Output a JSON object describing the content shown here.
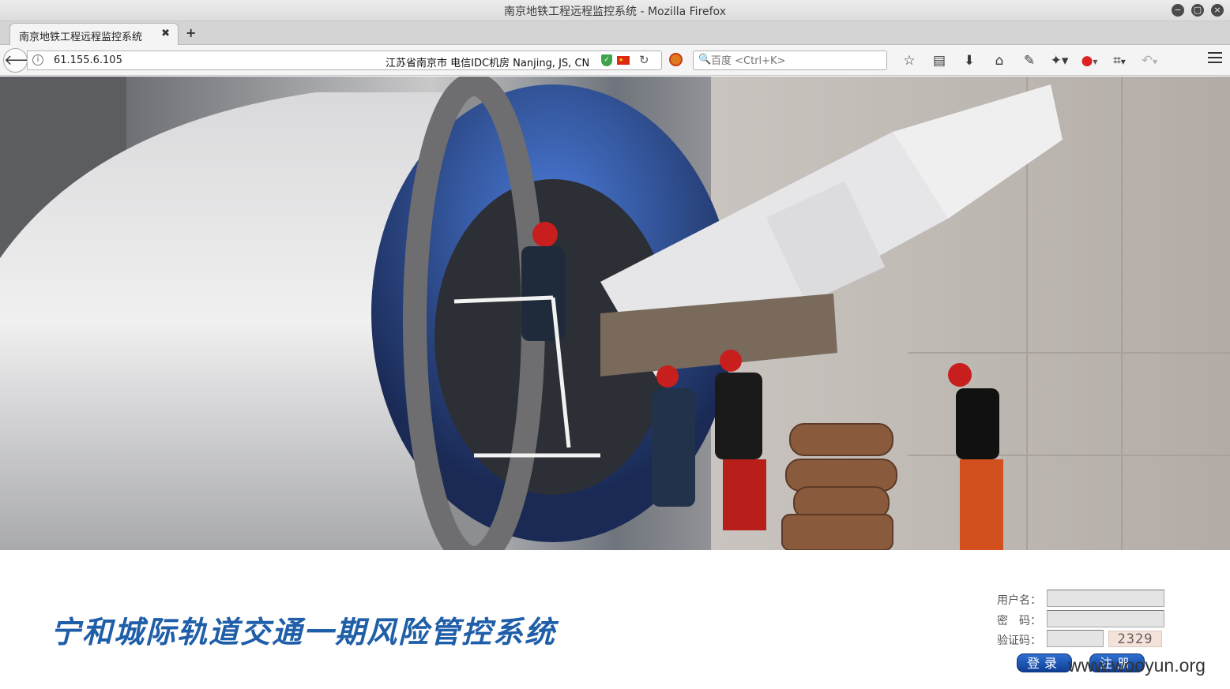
{
  "window": {
    "title": "南京地铁工程远程监控系统 - Mozilla Firefox",
    "controls": [
      "−",
      "▢",
      "×"
    ]
  },
  "tabs": [
    {
      "label": "南京地铁工程远程监控系统",
      "close": "✖",
      "active": true
    }
  ],
  "new_tab_label": "+",
  "navbar": {
    "back_icon": "arrow-left-icon",
    "url": "61.155.6.105",
    "geo_info": "江苏省南京市 电信IDC机房   Nanjing, JS, CN",
    "search_placeholder": "百度 <Ctrl+K>",
    "toolbar_icons": [
      "bookmark-star-icon",
      "reader-icon",
      "download-icon",
      "home-icon",
      "addon-icon",
      "addon-dropdown-icon",
      "addon-red-icon",
      "crop-icon",
      "undo-icon"
    ]
  },
  "banner": {
    "description_icon": "tunnel-boring-machine-photo"
  },
  "page": {
    "system_title": "宁和城际轨道交通一期风险管控系统",
    "login": {
      "username_label": "用户名：",
      "password_label": "密　码：",
      "captcha_label": "验证码：",
      "captcha_value": "2329",
      "login_button": "登录",
      "register_button": "注册"
    },
    "watermark": "www.wooyun.org"
  }
}
